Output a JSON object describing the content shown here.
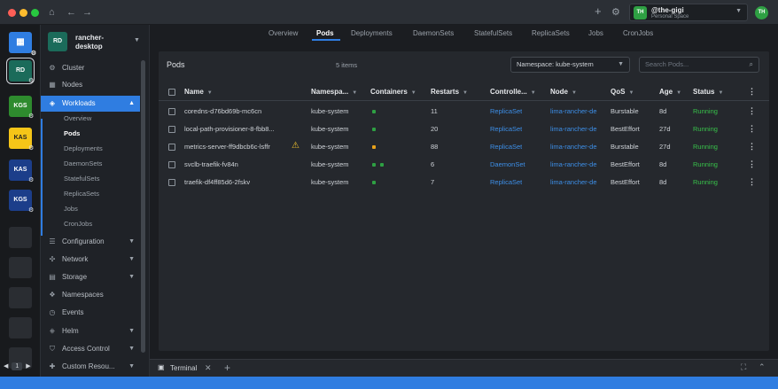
{
  "titlebar": {
    "window_controls": [
      "close",
      "minimize",
      "maximize"
    ],
    "nav_icons": [
      "home-icon",
      "back-icon",
      "forward-icon"
    ],
    "user": {
      "avatar_initials": "TH",
      "name": "@the-gigi",
      "space": "Personal Space",
      "profile_initials": "TH"
    }
  },
  "rail": {
    "clusters": [
      {
        "initials": "RD",
        "color": "#1b6b5a",
        "selected": true
      },
      {
        "initials": "KGS",
        "color": "#2e8b2e"
      },
      {
        "initials": "KAS",
        "color": "#f5c518"
      },
      {
        "initials": "KAS",
        "color": "#1c3e8a"
      },
      {
        "initials": "KGS",
        "color": "#1c3e8a"
      }
    ],
    "pager": {
      "page": "1"
    }
  },
  "nav": {
    "cluster": {
      "initials": "RD",
      "name": "rancher-desktop"
    },
    "items": [
      {
        "label": "Cluster",
        "icon": "cluster-icon"
      },
      {
        "label": "Nodes",
        "icon": "nodes-icon"
      },
      {
        "label": "Workloads",
        "icon": "workloads-icon",
        "active": true
      },
      {
        "label": "Configuration",
        "icon": "list-icon"
      },
      {
        "label": "Network",
        "icon": "network-icon"
      },
      {
        "label": "Storage",
        "icon": "storage-icon"
      },
      {
        "label": "Namespaces",
        "icon": "layers-icon"
      },
      {
        "label": "Events",
        "icon": "clock-icon"
      },
      {
        "label": "Helm",
        "icon": "helm-icon"
      },
      {
        "label": "Access Control",
        "icon": "shield-icon"
      },
      {
        "label": "Custom Resou...",
        "icon": "puzzle-icon"
      }
    ],
    "workload_subitems": [
      "Overview",
      "Pods",
      "Deployments",
      "DaemonSets",
      "StatefulSets",
      "ReplicaSets",
      "Jobs",
      "CronJobs"
    ]
  },
  "tabs": [
    "Overview",
    "Pods",
    "Deployments",
    "DaemonSets",
    "StatefulSets",
    "ReplicaSets",
    "Jobs",
    "CronJobs"
  ],
  "panel": {
    "title": "Pods",
    "count": "5 items",
    "namespace_select": "Namespace: kube-system",
    "search_placeholder": "Search Pods..."
  },
  "table": {
    "columns": [
      "Name",
      "Namespa...",
      "Containers",
      "Restarts",
      "Controlle...",
      "Node",
      "QoS",
      "Age",
      "Status"
    ],
    "rows": [
      {
        "name": "coredns-d76bd69b-mc6cn",
        "namespace": "kube-system",
        "containers": [
          "#2ea043"
        ],
        "restarts": "11",
        "controller": "ReplicaSet",
        "node": "lima-rancher-de",
        "qos": "Burstable",
        "age": "8d",
        "status": "Running",
        "warning": false
      },
      {
        "name": "local-path-provisioner-8-fbb8...",
        "namespace": "kube-system",
        "containers": [
          "#2ea043"
        ],
        "restarts": "20",
        "controller": "ReplicaSet",
        "node": "lima-rancher-de",
        "qos": "BestEffort",
        "age": "27d",
        "status": "Running",
        "warning": false
      },
      {
        "name": "metrics-server-ff9dbcb6c-lsffr",
        "namespace": "kube-system",
        "containers": [
          "#e8a21a"
        ],
        "restarts": "88",
        "controller": "ReplicaSet",
        "node": "lima-rancher-de",
        "qos": "Burstable",
        "age": "27d",
        "status": "Running",
        "warning": true
      },
      {
        "name": "svclb-traefik-fv84n",
        "namespace": "kube-system",
        "containers": [
          "#2ea043",
          "#2ea043"
        ],
        "restarts": "6",
        "controller": "DaemonSet",
        "node": "lima-rancher-de",
        "qos": "BestEffort",
        "age": "8d",
        "status": "Running",
        "warning": false
      },
      {
        "name": "traefik-df4ff85d6-2fskv",
        "namespace": "kube-system",
        "containers": [
          "#2ea043"
        ],
        "restarts": "7",
        "controller": "ReplicaSet",
        "node": "lima-rancher-de",
        "qos": "BestEffort",
        "age": "8d",
        "status": "Running",
        "warning": false
      }
    ]
  },
  "bottom": {
    "terminal_label": "Terminal"
  },
  "colors": {
    "accent": "#2f7de1",
    "running": "#38c24a",
    "link": "#3d8fe8",
    "warning": "#f0c22e"
  }
}
